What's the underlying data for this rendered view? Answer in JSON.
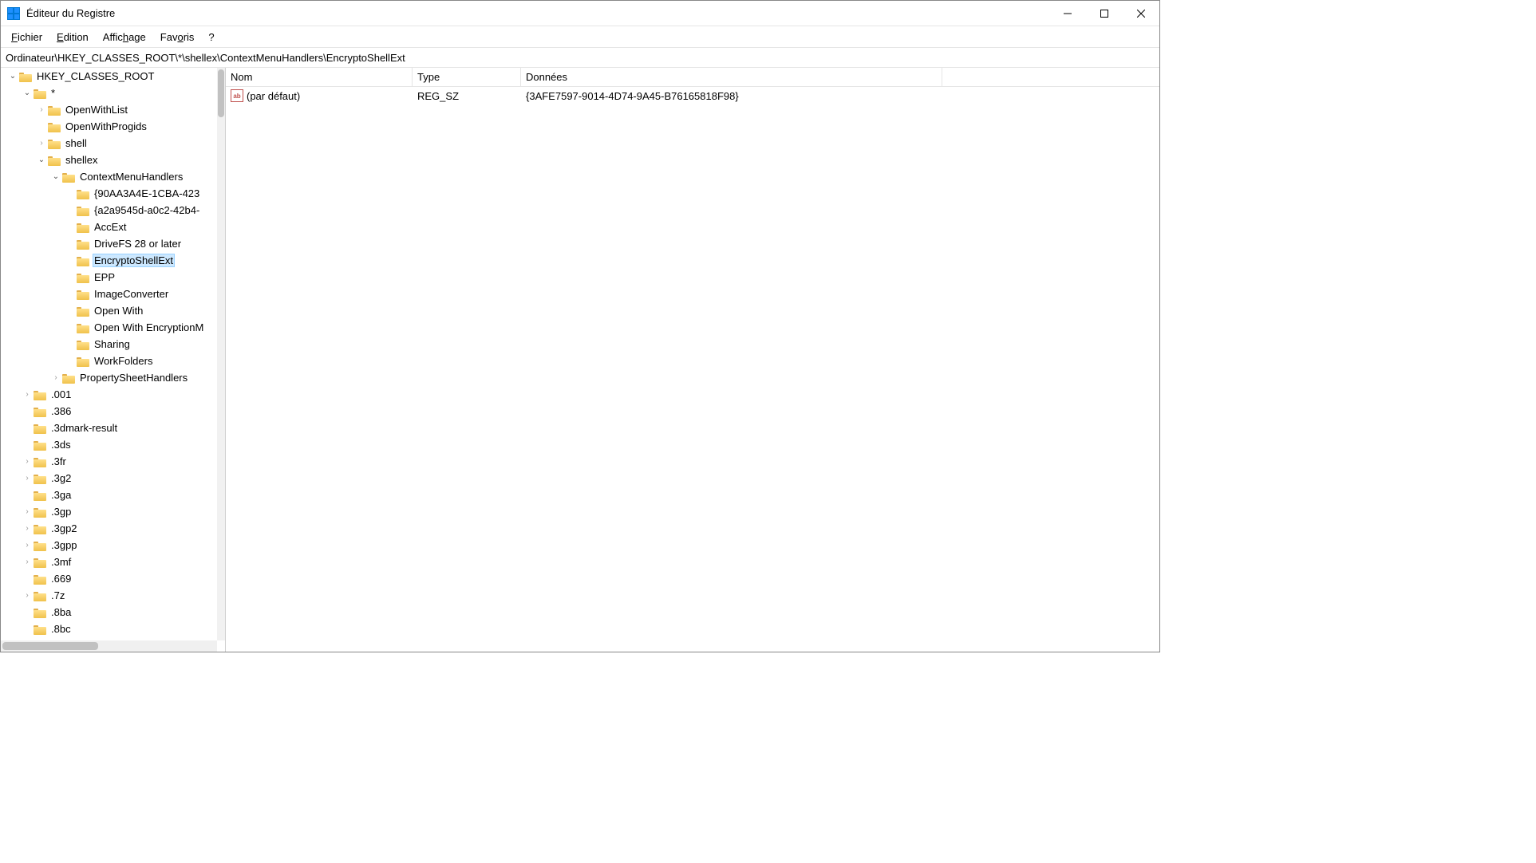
{
  "title": "Éditeur du Registre",
  "menu": {
    "file": "Fichier",
    "edit": "Edition",
    "view": "Affichage",
    "favorites": "Favoris",
    "help": "?"
  },
  "address": "Ordinateur\\HKEY_CLASSES_ROOT\\*\\shellex\\ContextMenuHandlers\\EncryptoShellExt",
  "tree": [
    {
      "indent": 0,
      "chev": "open",
      "label": "HKEY_CLASSES_ROOT",
      "selected": false
    },
    {
      "indent": 1,
      "chev": "open",
      "label": "*",
      "selected": false
    },
    {
      "indent": 2,
      "chev": "closed",
      "label": "OpenWithList",
      "selected": false
    },
    {
      "indent": 2,
      "chev": "none",
      "label": "OpenWithProgids",
      "selected": false
    },
    {
      "indent": 2,
      "chev": "closed",
      "label": "shell",
      "selected": false
    },
    {
      "indent": 2,
      "chev": "open",
      "label": "shellex",
      "selected": false
    },
    {
      "indent": 3,
      "chev": "open",
      "label": "ContextMenuHandlers",
      "selected": false
    },
    {
      "indent": 4,
      "chev": "none",
      "label": "{90AA3A4E-1CBA-423",
      "selected": false
    },
    {
      "indent": 4,
      "chev": "none",
      "label": "{a2a9545d-a0c2-42b4-",
      "selected": false
    },
    {
      "indent": 4,
      "chev": "none",
      "label": "AccExt",
      "selected": false
    },
    {
      "indent": 4,
      "chev": "none",
      "label": "DriveFS 28 or later",
      "selected": false
    },
    {
      "indent": 4,
      "chev": "none",
      "label": "EncryptoShellExt",
      "selected": true
    },
    {
      "indent": 4,
      "chev": "none",
      "label": "EPP",
      "selected": false
    },
    {
      "indent": 4,
      "chev": "none",
      "label": "ImageConverter",
      "selected": false
    },
    {
      "indent": 4,
      "chev": "none",
      "label": "Open With",
      "selected": false
    },
    {
      "indent": 4,
      "chev": "none",
      "label": "Open With EncryptionM",
      "selected": false
    },
    {
      "indent": 4,
      "chev": "none",
      "label": "Sharing",
      "selected": false
    },
    {
      "indent": 4,
      "chev": "none",
      "label": "WorkFolders",
      "selected": false
    },
    {
      "indent": 3,
      "chev": "closed",
      "label": "PropertySheetHandlers",
      "selected": false
    },
    {
      "indent": 1,
      "chev": "closed",
      "label": ".001",
      "selected": false
    },
    {
      "indent": 1,
      "chev": "none",
      "label": ".386",
      "selected": false
    },
    {
      "indent": 1,
      "chev": "none",
      "label": ".3dmark-result",
      "selected": false
    },
    {
      "indent": 1,
      "chev": "none",
      "label": ".3ds",
      "selected": false
    },
    {
      "indent": 1,
      "chev": "closed",
      "label": ".3fr",
      "selected": false
    },
    {
      "indent": 1,
      "chev": "closed",
      "label": ".3g2",
      "selected": false
    },
    {
      "indent": 1,
      "chev": "none",
      "label": ".3ga",
      "selected": false
    },
    {
      "indent": 1,
      "chev": "closed",
      "label": ".3gp",
      "selected": false
    },
    {
      "indent": 1,
      "chev": "closed",
      "label": ".3gp2",
      "selected": false
    },
    {
      "indent": 1,
      "chev": "closed",
      "label": ".3gpp",
      "selected": false
    },
    {
      "indent": 1,
      "chev": "closed",
      "label": ".3mf",
      "selected": false
    },
    {
      "indent": 1,
      "chev": "none",
      "label": ".669",
      "selected": false
    },
    {
      "indent": 1,
      "chev": "closed",
      "label": ".7z",
      "selected": false
    },
    {
      "indent": 1,
      "chev": "none",
      "label": ".8ba",
      "selected": false
    },
    {
      "indent": 1,
      "chev": "none",
      "label": ".8bc",
      "selected": false
    }
  ],
  "columns": {
    "name": "Nom",
    "type": "Type",
    "data": "Données"
  },
  "values": [
    {
      "name": "(par défaut)",
      "type": "REG_SZ",
      "data": "{3AFE7597-9014-4D74-9A45-B76165818F98}"
    }
  ]
}
